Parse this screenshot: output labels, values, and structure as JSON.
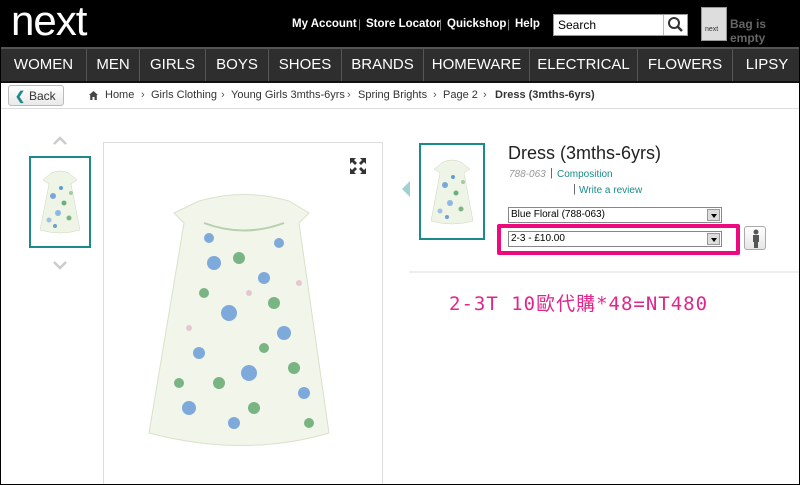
{
  "header": {
    "logo": "next",
    "links": [
      "My Account",
      "Store Locator",
      "Quickshop",
      "Help"
    ],
    "search": {
      "placeholder": "Search",
      "value": "Search"
    },
    "bag": {
      "icon_text": "next",
      "label": "Bag is empty"
    }
  },
  "nav": {
    "items": [
      "WOMEN",
      "MEN",
      "GIRLS",
      "BOYS",
      "SHOES",
      "BRANDS",
      "HOMEWARE",
      "ELECTRICAL",
      "FLOWERS",
      "LIPSY"
    ]
  },
  "breadcrumb": {
    "back_label": "Back",
    "items": [
      "Home",
      "Girls Clothing",
      "Young Girls 3mths-6yrs",
      "Spring Brights",
      "Page 2"
    ],
    "current": "Dress (3mths-6yrs)"
  },
  "product": {
    "title": "Dress (3mths-6yrs)",
    "code": "788-063",
    "composition_label": "Composition",
    "review_label": "Write a review",
    "color_option": "Blue Floral (788-063)",
    "size_option": "2-3 - £10.00"
  },
  "annotation": "2-3T  10歐代購*48=NT480",
  "colors": {
    "accent": "#1a8a8a",
    "highlight": "#ec0a7e",
    "header_bg": "#000000",
    "nav_bg": "#2e2e2e"
  }
}
